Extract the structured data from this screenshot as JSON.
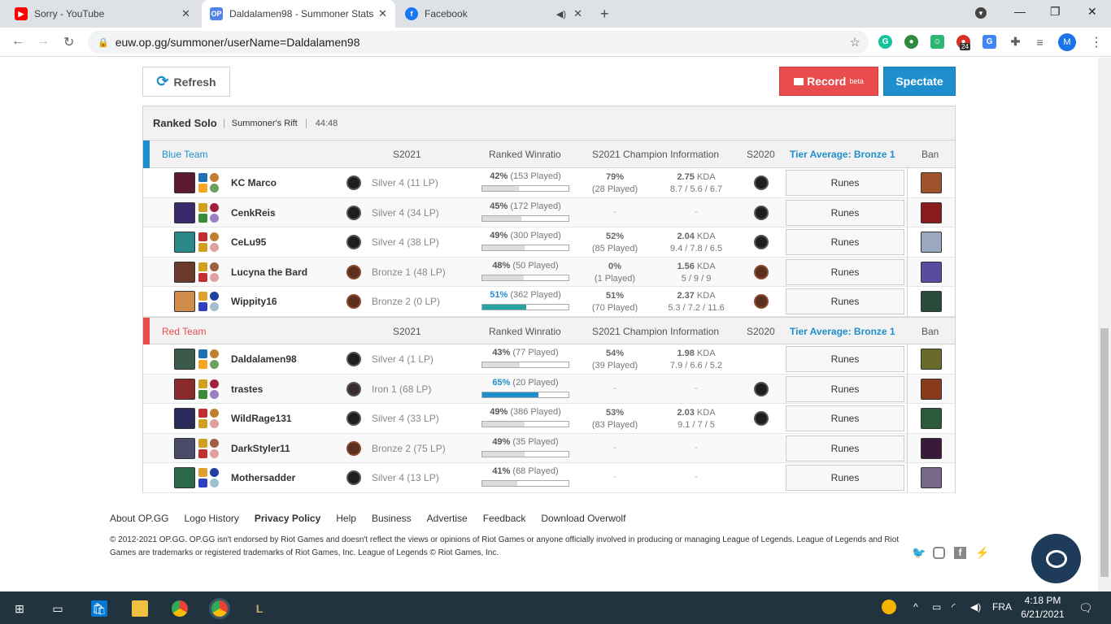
{
  "browser": {
    "tabs": [
      {
        "title": "Sorry - YouTube",
        "icon": "youtube-icon",
        "color": "#ff0000"
      },
      {
        "title": "Daldalamen98 - Summoner Stats",
        "icon": "opgg-icon",
        "color": "#5383e8"
      },
      {
        "title": "Facebook",
        "icon": "facebook-icon",
        "color": "#1877f2"
      }
    ],
    "url": "euw.op.gg/summoner/userName=Daldalamen98",
    "notification_badge": "24",
    "profile_initial": "M"
  },
  "actions": {
    "refresh": "Refresh",
    "record": "Record",
    "record_sup": "beta",
    "spectate": "Spectate"
  },
  "game": {
    "type": "Ranked Solo",
    "map": "Summoner's Rift",
    "time": "44:48"
  },
  "columns": {
    "s2021": "S2021",
    "winratio": "Ranked Winratio",
    "champ_info": "S2021 Champion Information",
    "s2020": "S2020",
    "tier_avg": "Tier Average: Bronze 1",
    "ban": "Ban",
    "runes": "Runes"
  },
  "teams": [
    {
      "name": "Blue Team",
      "color": "#1f8ecd",
      "players": [
        {
          "name": "KC Marco",
          "tier": "Silver 4 (11 LP)",
          "tier_class": "silver",
          "wr_pct": "42%",
          "wr_played": "(153 Played)",
          "wr": 0.42,
          "fill": "grey",
          "champ_wr": "79%",
          "champ_played": "(28 Played)",
          "kda": "2.75",
          "kda_label": "KDA",
          "kda_detail": "8.7 / 5.6 / 6.7",
          "s2020": "silver",
          "champ_color": "#5b1a2e",
          "ban_color": "#a0522d"
        },
        {
          "name": "CenkReis",
          "tier": "Silver 4 (34 LP)",
          "tier_class": "silver",
          "wr_pct": "45%",
          "wr_played": "(172 Played)",
          "wr": 0.45,
          "fill": "grey",
          "champ_wr": "-",
          "champ_played": "",
          "kda": "-",
          "kda_label": "",
          "kda_detail": "",
          "s2020": "silver",
          "champ_color": "#3a2a6b",
          "ban_color": "#8b1a1a"
        },
        {
          "name": "CeLu95",
          "tier": "Silver 4 (38 LP)",
          "tier_class": "silver",
          "wr_pct": "49%",
          "wr_played": "(300 Played)",
          "wr": 0.49,
          "fill": "grey",
          "champ_wr": "52%",
          "champ_played": "(85 Played)",
          "kda": "2.04",
          "kda_label": "KDA",
          "kda_detail": "9.4 / 7.8 / 6.5",
          "s2020": "silver",
          "champ_color": "#2a8a8a",
          "ban_color": "#9aa8c0"
        },
        {
          "name": "Lucyna the Bard",
          "tier": "Bronze 1 (48 LP)",
          "tier_class": "bronze",
          "wr_pct": "48%",
          "wr_played": "(50 Played)",
          "wr": 0.48,
          "fill": "grey",
          "champ_wr": "0%",
          "champ_played": "(1 Played)",
          "kda": "1.56",
          "kda_label": "KDA",
          "kda_detail": "5 / 9 / 9",
          "s2020": "bronze",
          "champ_color": "#6b3a2a",
          "ban_color": "#5a4aa0"
        },
        {
          "name": "Wippity16",
          "tier": "Bronze 2 (0 LP)",
          "tier_class": "bronze",
          "wr_pct": "51%",
          "wr_played": "(362 Played)",
          "wr": 0.51,
          "fill": "teal",
          "champ_wr": "51%",
          "champ_played": "(70 Played)",
          "kda": "2.37",
          "kda_label": "KDA",
          "kda_detail": "5.3 / 7.2 / 11.6",
          "s2020": "bronze",
          "champ_color": "#d08a4a",
          "ban_color": "#2a4a3a"
        }
      ]
    },
    {
      "name": "Red Team",
      "color": "#e84c4c",
      "players": [
        {
          "name": "Daldalamen98",
          "tier": "Silver 4 (1 LP)",
          "tier_class": "silver",
          "wr_pct": "43%",
          "wr_played": "(77 Played)",
          "wr": 0.43,
          "fill": "grey",
          "champ_wr": "54%",
          "champ_played": "(39 Played)",
          "kda": "1.98",
          "kda_label": "KDA",
          "kda_detail": "7.9 / 6.6 / 5.2",
          "s2020": "",
          "champ_color": "#3a5a4a",
          "ban_color": "#6a6a2a"
        },
        {
          "name": "trastes",
          "tier": "Iron 1 (68 LP)",
          "tier_class": "iron",
          "wr_pct": "65%",
          "wr_played": "(20 Played)",
          "wr": 0.65,
          "fill": "blue",
          "champ_wr": "-",
          "champ_played": "",
          "kda": "-",
          "kda_label": "",
          "kda_detail": "",
          "s2020": "iron",
          "champ_color": "#8a2a2a",
          "ban_color": "#8a3a1a"
        },
        {
          "name": "WildRage131",
          "tier": "Silver 4 (33 LP)",
          "tier_class": "silver",
          "wr_pct": "49%",
          "wr_played": "(386 Played)",
          "wr": 0.49,
          "fill": "grey",
          "champ_wr": "53%",
          "champ_played": "(83 Played)",
          "kda": "2.03",
          "kda_label": "KDA",
          "kda_detail": "9.1 / 7 / 5",
          "s2020": "silver",
          "champ_color": "#2a2a5a",
          "ban_color": "#2a5a3a"
        },
        {
          "name": "DarkStyler11",
          "tier": "Bronze 2 (75 LP)",
          "tier_class": "bronze",
          "wr_pct": "49%",
          "wr_played": "(35 Played)",
          "wr": 0.49,
          "fill": "grey",
          "champ_wr": "-",
          "champ_played": "",
          "kda": "-",
          "kda_label": "",
          "kda_detail": "",
          "s2020": "",
          "champ_color": "#4a4a6a",
          "ban_color": "#3a1a3a"
        },
        {
          "name": "Mothersadder",
          "tier": "Silver 4 (13 LP)",
          "tier_class": "silver",
          "wr_pct": "41%",
          "wr_played": "(68 Played)",
          "wr": 0.41,
          "fill": "grey",
          "champ_wr": "-",
          "champ_played": "",
          "kda": "-",
          "kda_label": "",
          "kda_detail": "",
          "s2020": "",
          "champ_color": "#2a6a4a",
          "ban_color": "#7a6a8a"
        }
      ]
    }
  ],
  "footer": {
    "links": [
      "About OP.GG",
      "Logo History",
      "Privacy Policy",
      "Help",
      "Business",
      "Advertise",
      "Feedback",
      "Download Overwolf"
    ],
    "copyright": "© 2012-2021 OP.GG. OP.GG isn't endorsed by Riot Games and doesn't reflect the views or opinions of Riot Games or anyone officially involved in producing or managing League of Legends. League of Legends and Riot Games are trademarks or registered trademarks of Riot Games, Inc. League of Legends © Riot Games, Inc."
  },
  "taskbar": {
    "lang": "FRA",
    "time": "4:18 PM",
    "date": "6/21/2021"
  }
}
